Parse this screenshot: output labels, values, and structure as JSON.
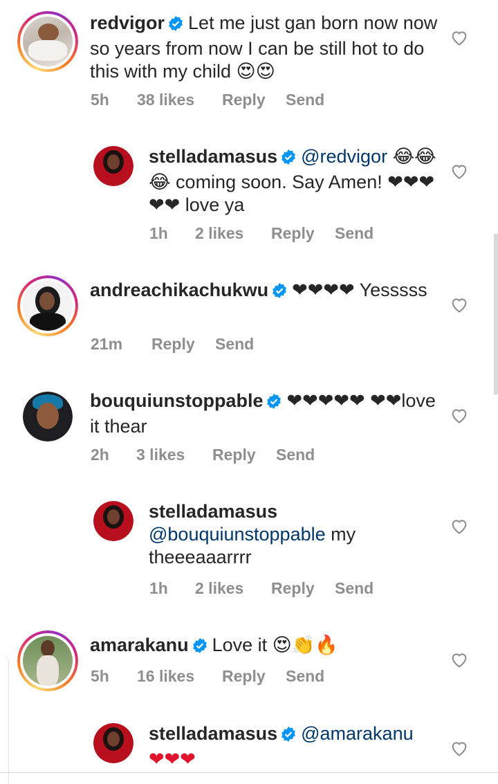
{
  "comments": [
    {
      "username": "redvigor",
      "text": "Let me just gan born now now so years from now I can be still hot to do this with my child 😍😍",
      "time": "5h",
      "likes": "38 likes",
      "reply": "Reply",
      "send": "Send"
    },
    {
      "username": "stelladamasus",
      "mention": "@redvigor",
      "text": "😂😂😂 coming soon. Say Amen! ❤❤❤❤❤ love ya",
      "time": "1h",
      "likes": "2 likes",
      "reply": "Reply",
      "send": "Send"
    },
    {
      "username": "andreachikachukwu",
      "text": "❤❤❤❤ Yesssss",
      "time": "21m",
      "reply": "Reply",
      "send": "Send"
    },
    {
      "username": "bouquiunstoppable",
      "text": "❤❤❤❤❤ ❤❤love it thear",
      "time": "2h",
      "likes": "3 likes",
      "reply": "Reply",
      "send": "Send"
    },
    {
      "username": "stelladamasus",
      "mention": "@bouquiunstoppable",
      "text": "my theeeaaarrrr",
      "time": "1h",
      "likes": "2 likes",
      "reply": "Reply",
      "send": "Send"
    },
    {
      "username": "amarakanu",
      "text": "Love it 😍👏🔥",
      "time": "5h",
      "likes": "16 likes",
      "reply": "Reply",
      "send": "Send"
    },
    {
      "username": "stelladamasus",
      "mention": "@amarakanu",
      "text": "❤❤❤"
    }
  ],
  "colors": {
    "text": "#262626",
    "meta": "#8e8e8e",
    "mention": "#00376b",
    "verified": "#0095f6",
    "heart": "#e0142c"
  }
}
